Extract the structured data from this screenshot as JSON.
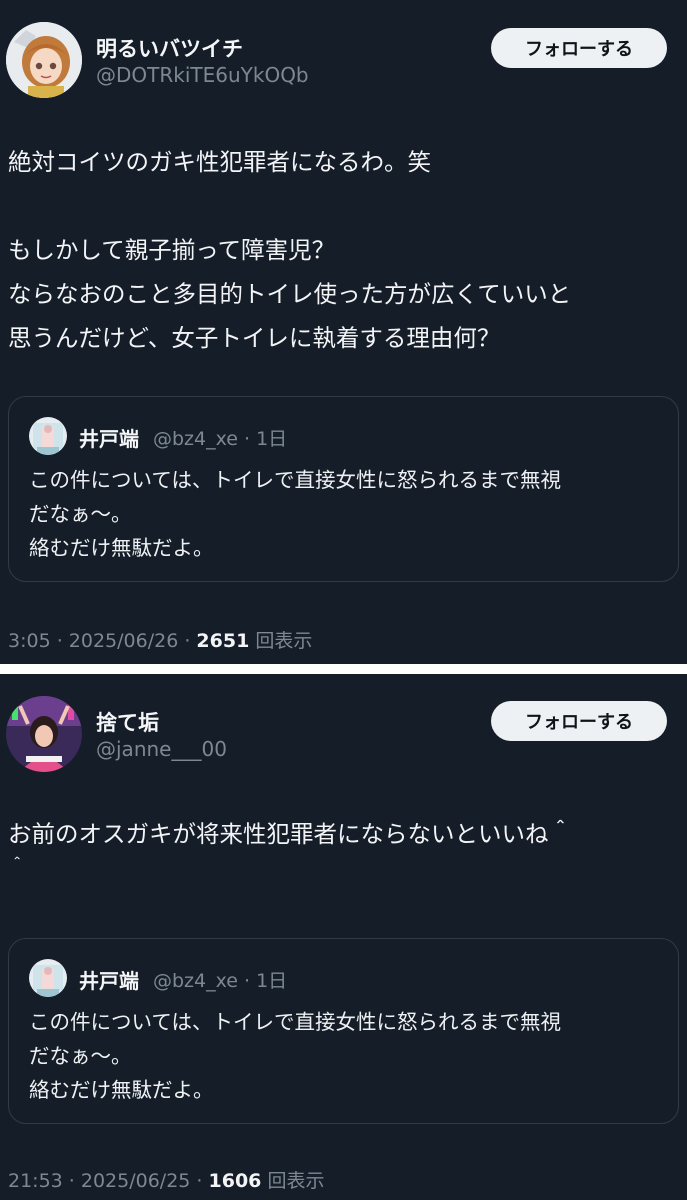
{
  "posts": [
    {
      "display_name": "明るいバツイチ",
      "handle": "@DOTRkiTE6uYkOQb",
      "follow_label": "フォローする",
      "body_lines": [
        "絶対コイツのガキ性犯罪者になるわ。笑",
        "",
        "もしかして親子揃って障害児？",
        "ならなおのこと多目的トイレ使った方が広くていいと",
        "思うんだけど、女子トイレに執着する理由何？"
      ],
      "quote": {
        "name": "井戸端",
        "handle_time": "@bz4_xe · 1日",
        "lines": [
          "この件については、トイレで直接女性に怒られるまで無視",
          "だなぁ〜。",
          "絡むだけ無駄だよ。"
        ]
      },
      "meta": {
        "time_date": "3:05 · 2025/06/26 · ",
        "views": "2651",
        "views_label": " 回表示"
      }
    },
    {
      "display_name": "捨て垢",
      "handle": "@janne___00",
      "follow_label": "フォローする",
      "body_lines": [
        "お前のオスガキが将来性犯罪者にならないといいね＾",
        "＾"
      ],
      "quote": {
        "name": "井戸端",
        "handle_time": "@bz4_xe · 1日",
        "lines": [
          "この件については、トイレで直接女性に怒られるまで無視",
          "だなぁ〜。",
          "絡むだけ無駄だよ。"
        ]
      },
      "meta": {
        "time_date": "21:53 · 2025/06/25 · ",
        "views": "1606",
        "views_label": " 回表示"
      }
    }
  ],
  "colors": {
    "background": "#151d28",
    "text": "#f2f4f6",
    "muted": "#7d8893",
    "border": "#313b46",
    "button_bg": "#eef1f3"
  }
}
